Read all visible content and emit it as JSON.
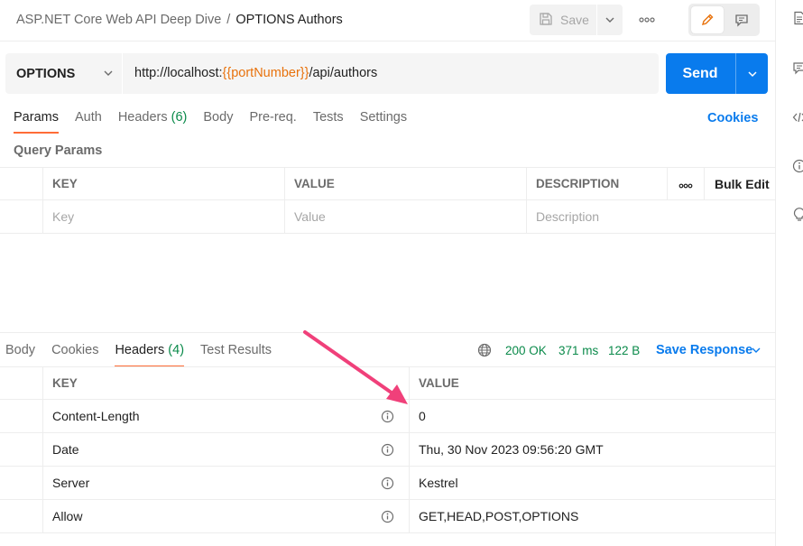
{
  "header": {
    "breadcrumb_parent": "ASP.NET Core Web API Deep Dive",
    "breadcrumb_separator": "/",
    "breadcrumb_current": "OPTIONS Authors",
    "save_label": "Save",
    "more_label": "ooo"
  },
  "request": {
    "method": "OPTIONS",
    "url_prefix": "http://localhost:",
    "url_variable": "{{portNumber}}",
    "url_suffix": "/api/authors",
    "send_label": "Send"
  },
  "request_tabs": {
    "params": "Params",
    "auth": "Auth",
    "headers": "Headers",
    "headers_count": "(6)",
    "body": "Body",
    "prereq": "Pre-req.",
    "tests": "Tests",
    "settings": "Settings",
    "cookies_link": "Cookies"
  },
  "query_params": {
    "section_label": "Query Params",
    "columns": {
      "key": "KEY",
      "value": "VALUE",
      "description": "DESCRIPTION",
      "more": "ooo",
      "bulk_edit": "Bulk Edit"
    },
    "placeholders": {
      "key": "Key",
      "value": "Value",
      "description": "Description"
    }
  },
  "response": {
    "tabs": {
      "body": "Body",
      "cookies": "Cookies",
      "headers": "Headers",
      "headers_count": "(4)",
      "test_results": "Test Results"
    },
    "status": "200 OK",
    "time": "371 ms",
    "size": "122 B",
    "save_response_label": "Save Response",
    "columns": {
      "key": "KEY",
      "value": "VALUE"
    },
    "headers": [
      {
        "key": "Content-Length",
        "value": "0"
      },
      {
        "key": "Date",
        "value": "Thu, 30 Nov 2023 09:56:20 GMT"
      },
      {
        "key": "Server",
        "value": "Kestrel"
      },
      {
        "key": "Allow",
        "value": "GET,HEAD,POST,OPTIONS"
      }
    ]
  },
  "colors": {
    "accent_blue": "#097bed",
    "tab_underline": "#ff6c37",
    "variable_orange": "#e8720c",
    "status_green": "#0a8a4a",
    "annotation_pink": "#f0407a"
  },
  "icons": {
    "save": "floppy-disk-icon",
    "caret": "chevron-down-icon",
    "edit": "pencil-icon",
    "doc": "comment-icon",
    "globe": "globe-icon",
    "info": "info-icon"
  }
}
